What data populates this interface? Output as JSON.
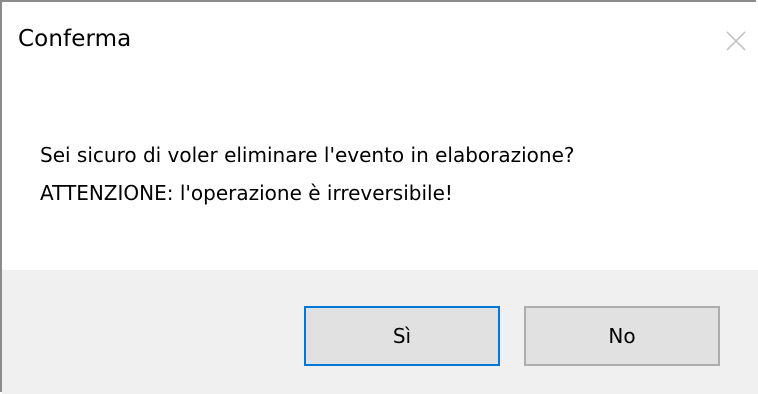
{
  "dialog": {
    "title": "Conferma",
    "close_icon": "close-icon",
    "message_line1": "Sei sicuro di voler eliminare l'evento in elaborazione?",
    "message_line2": "ATTENZIONE: l'operazione è irreversibile!",
    "buttons": {
      "yes_label": "Sì",
      "no_label": "No"
    }
  },
  "colors": {
    "default_button_border": "#0078d7",
    "button_background": "#e1e1e1",
    "footer_background": "#f0f0f0"
  }
}
